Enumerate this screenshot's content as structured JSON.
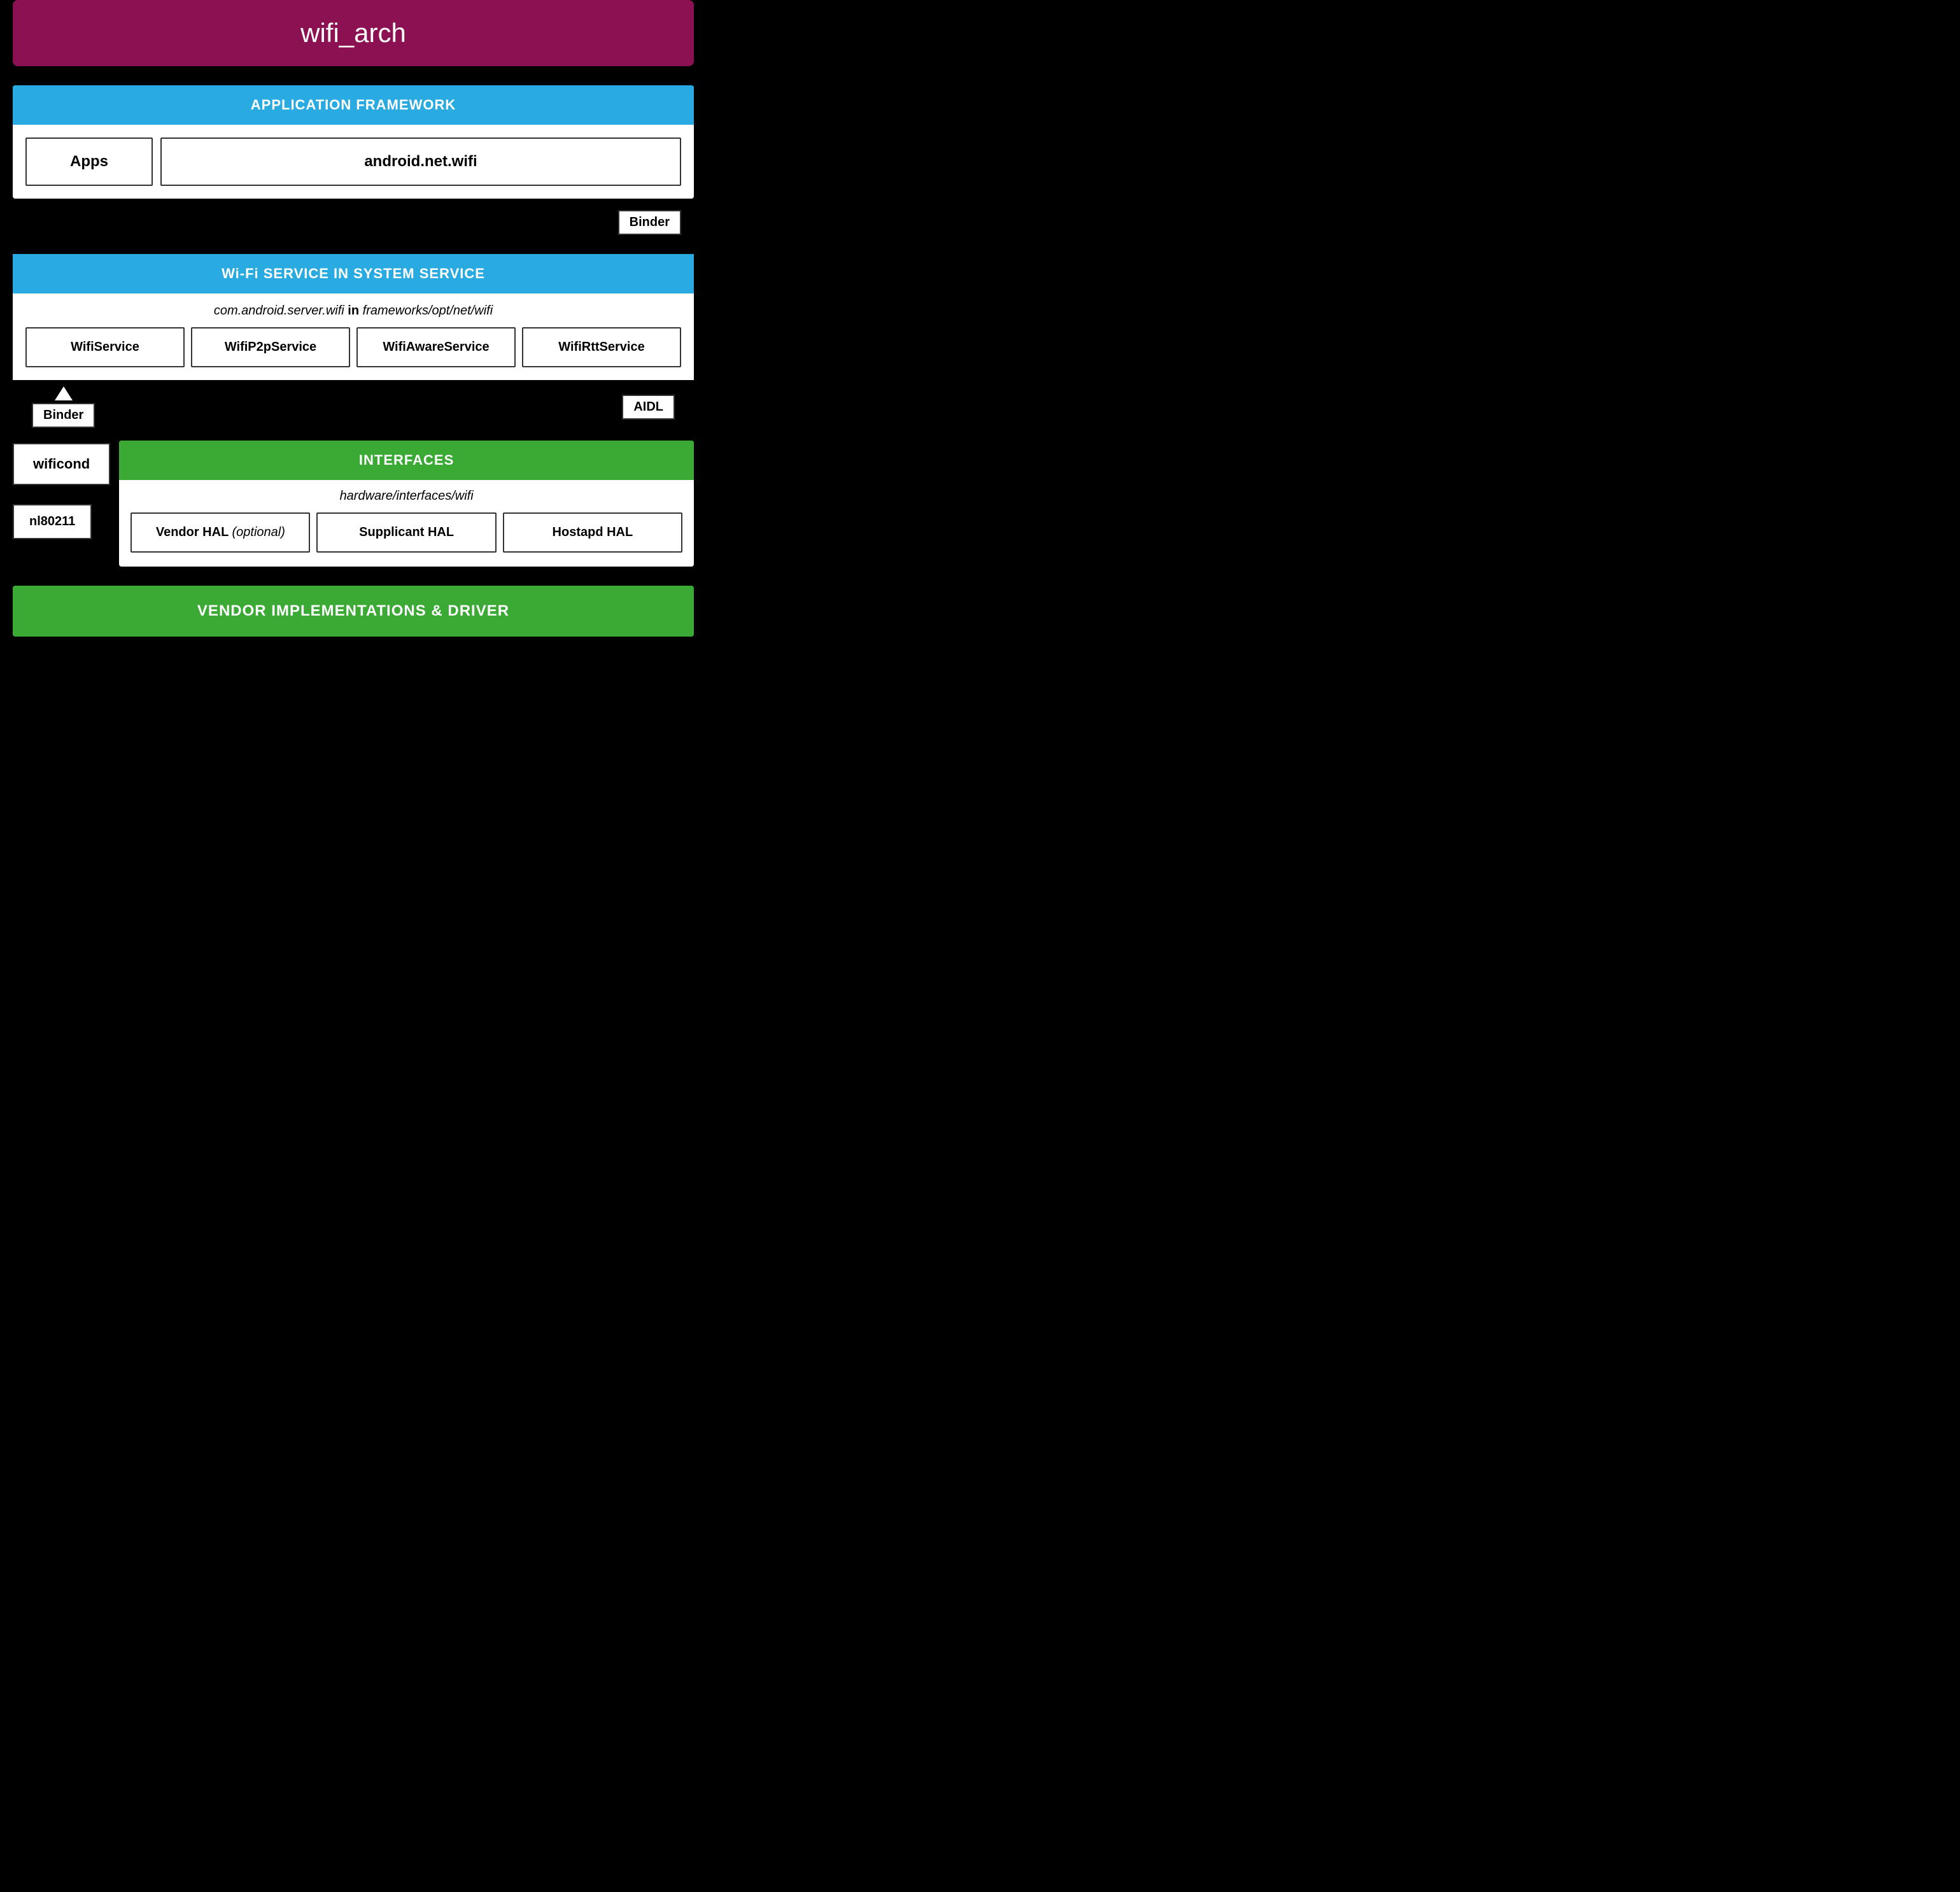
{
  "title": "wifi_arch",
  "app_framework": {
    "header": "APPLICATION FRAMEWORK",
    "apps_label": "Apps",
    "android_wifi_label": "android.net.wifi"
  },
  "binder_top": "Binder",
  "wifi_service": {
    "header": "Wi-Fi SERVICE IN SYSTEM SERVICE",
    "path_italic": "com.android.server.wifi",
    "path_in": "in",
    "path_location": "frameworks/opt/net/wifi",
    "services": [
      "WifiService",
      "WifiP2pService",
      "WifiAwareService",
      "WifiRttService"
    ]
  },
  "binder_left": "Binder",
  "aidl_label": "AIDL",
  "wificond_label": "wificond",
  "nl80211_label": "nl80211",
  "interfaces": {
    "header": "INTERFACES",
    "path": "hardware/interfaces/wifi",
    "hal_boxes": [
      {
        "label": "Vendor HAL",
        "optional": true
      },
      {
        "label": "Supplicant HAL",
        "optional": false
      },
      {
        "label": "Hostapd HAL",
        "optional": false
      }
    ]
  },
  "vendor_bar": "VENDOR IMPLEMENTATIONS & DRIVER"
}
